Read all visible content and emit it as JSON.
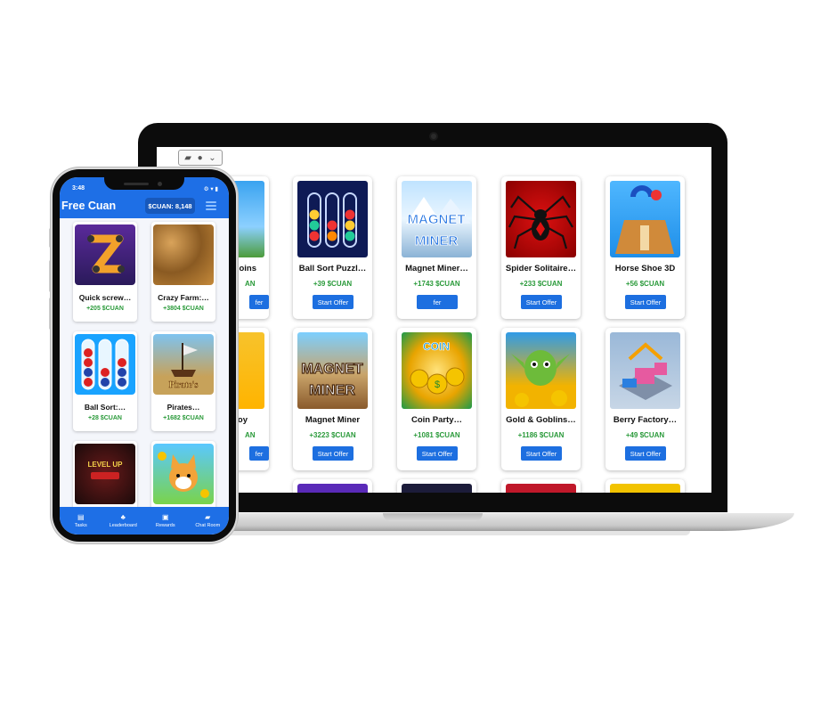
{
  "laptop": {
    "platform_icons": [
      "android-icon",
      "apple-icon"
    ],
    "platform_chevron": "⌄",
    "offers": [
      {
        "title": "ls Coins",
        "reward": "AN",
        "button": "fer",
        "icon": "coins-island-thumbnail"
      },
      {
        "title": "Ball Sort Puzzl…",
        "reward": "+39 $CUAN",
        "button": "Start Offer",
        "icon": "ball-sort-thumbnail"
      },
      {
        "title": "Magnet Miner…",
        "reward": "+1743 $CUAN",
        "button": "Start Offer",
        "icon": "magnet-miner-winter-thumbnail"
      },
      {
        "title": "Spider Solitaire…",
        "reward": "+233 $CUAN",
        "button": "Start Offer",
        "icon": "spider-solitaire-thumbnail"
      },
      {
        "title": "Horse Shoe 3D",
        "reward": "+56 $CUAN",
        "button": "Start Offer",
        "icon": "horse-shoe-thumbnail"
      },
      {
        "title": "Toy",
        "reward": "AN",
        "button": "fer",
        "icon": "toy-thumbnail"
      },
      {
        "title": "Magnet Miner",
        "reward": "+3223 $CUAN",
        "button": "Start Offer",
        "icon": "magnet-miner-thumbnail"
      },
      {
        "title": "Coin Party…",
        "reward": "+1081 $CUAN",
        "button": "Start Offer",
        "icon": "coin-party-thumbnail"
      },
      {
        "title": "Gold & Goblins…",
        "reward": "+1186 $CUAN",
        "button": "Start Offer",
        "icon": "gold-goblins-thumbnail"
      },
      {
        "title": "Berry Factory…",
        "reward": "+49 $CUAN",
        "button": "Start Offer",
        "icon": "berry-factory-thumbnail"
      }
    ]
  },
  "phone": {
    "status_time": "3:48",
    "status_right": "⚙ ▾ ▮",
    "app_title": "Free Cuan",
    "balance": "$CUAN: 8,148",
    "offers": [
      {
        "title": "Quick screw…",
        "reward": "+205 $CUAN",
        "icon": "quick-screw-thumbnail"
      },
      {
        "title": "Crazy Farm:…",
        "reward": "+3804 $CUAN",
        "icon": "crazy-farm-thumbnail"
      },
      {
        "title": "Ball Sort:…",
        "reward": "+28 $CUAN",
        "icon": "ball-sort-thumbnail"
      },
      {
        "title": "Pirates…",
        "reward": "+1682 $CUAN",
        "icon": "pirates-treasure-thumbnail"
      },
      {
        "title": "",
        "reward": "",
        "icon": "level-up-thumbnail"
      },
      {
        "title": "",
        "reward": "",
        "icon": "shiba-game-thumbnail"
      }
    ],
    "nav": [
      {
        "label": "Tasks",
        "icon": "tasks-icon",
        "glyph": "▤"
      },
      {
        "label": "Leaderboard",
        "icon": "leaderboard-icon",
        "glyph": "♣"
      },
      {
        "label": "Rewards",
        "icon": "gift-icon",
        "glyph": "▣"
      },
      {
        "label": "Chat Room",
        "icon": "chat-icon",
        "glyph": "▰"
      }
    ]
  },
  "colors": {
    "primary_blue": "#1e6fe6",
    "button_blue": "#1d6fe0",
    "reward_green": "#2a9a3a"
  }
}
